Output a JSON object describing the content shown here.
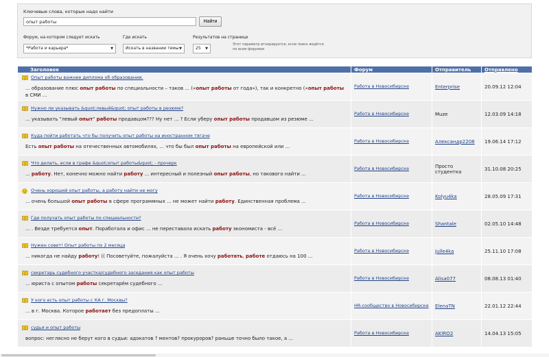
{
  "search": {
    "keywords_label": "Ключевые слова, которые надо найти",
    "keywords_value": "опыт работы",
    "find_button": "Найти",
    "forum_label": "Форум, на котором следует искать",
    "forum_value": "*Работа и карьера*",
    "where_label": "Где искать",
    "where_value": "Искать в названии темы",
    "per_page_label": "Результатов на странице",
    "per_page_value": "25",
    "per_page_note": "Этот параметр игнорируется, если поиск ведётся по всем форумам"
  },
  "table": {
    "headers": {
      "title": "Заголовок",
      "forum": "Форум",
      "sender": "Отправитель",
      "posted": "Отправлено"
    },
    "rows": [
      {
        "icon": "book-icon",
        "title": "Опыт работы важнее диплома об образовании.",
        "snippet_parts": [
          [
            "... образование плюс ",
            false
          ],
          [
            "опыт работы",
            true
          ],
          [
            " по специальности – таков ... («",
            false
          ],
          [
            "опыт работы",
            true
          ],
          [
            " от года»), так и конкретно («",
            false
          ],
          [
            "опыт работы",
            true
          ],
          [
            " в СМИ ...",
            false
          ]
        ],
        "forum": "Работа в Новосибирске",
        "sender": "Enterprise",
        "sender_link": true,
        "date": "20.09.12 12:04"
      },
      {
        "icon": "book-icon",
        "title": "Нужно ли указывать &quot;левый&quot; опыт работы в резюме?",
        "snippet_parts": [
          [
            "... указывать \"левый ",
            false
          ],
          [
            "опыт",
            true
          ],
          [
            "\" ",
            false
          ],
          [
            "работы",
            true
          ],
          [
            " продавцом??? Ну нет ... ? Если уберу ",
            false
          ],
          [
            "опыт работы",
            true
          ],
          [
            " продавцом из резюме ...",
            false
          ]
        ],
        "forum": "Работа в Новосибирске",
        "sender": "Muze",
        "sender_link": false,
        "date": "12.03.09 14:18"
      },
      {
        "icon": "book-icon",
        "title": "Куда пойти работать что бы получить опыт работы на иностранном тягаче",
        "snippet_parts": [
          [
            "Есть ",
            false
          ],
          [
            "опыт работы",
            true
          ],
          [
            " на отечественных автомобилях, ... что бы был ",
            false
          ],
          [
            "опыт работы",
            true
          ],
          [
            " на европейской или ...",
            false
          ]
        ],
        "forum": "Работа в Новосибирске",
        "sender": "Александр2208",
        "sender_link": true,
        "date": "19.06.14 17:12"
      },
      {
        "icon": "book-icon",
        "title": "Что делать, если в графе &quot;опыт работы&quot; - прочерк",
        "snippet_parts": [
          [
            "... ",
            false
          ],
          [
            "работу",
            true
          ],
          [
            ". Нет, конечно можно найти ",
            false
          ],
          [
            "работу",
            true
          ],
          [
            " ... интересный и полезный ",
            false
          ],
          [
            "опыт работы",
            true
          ],
          [
            ", но такового найти ...",
            false
          ]
        ],
        "forum": "Работа в Новосибирске",
        "sender": "Просто студентка",
        "sender_link": false,
        "date": "31.10.08 20:25"
      },
      {
        "icon": "smiley-icon",
        "title": "Очень хороший опыт работы, а работу найти не могу",
        "snippet_parts": [
          [
            "... очень большой ",
            false
          ],
          [
            "опыт работы",
            true
          ],
          [
            " в сфере программных ... не может найти ",
            false
          ],
          [
            "работу",
            true
          ],
          [
            ". Единственная проблема ...",
            false
          ]
        ],
        "forum": "Работа в Новосибирске",
        "sender": "Kolyu4ka",
        "sender_link": true,
        "date": "28.05.09 17:31"
      },
      {
        "icon": "book-icon",
        "title": "Где получать опыт работы по специальности?",
        "snippet_parts": [
          [
            "... . Везде требуется ",
            false
          ],
          [
            "опыт",
            true
          ],
          [
            ". Поработала и офис ... не переставала искать ",
            false
          ],
          [
            "работу",
            true
          ],
          [
            " экономиста - всё ...",
            false
          ]
        ],
        "forum": "Работа в Новосибирске",
        "sender": "Shantale",
        "sender_link": true,
        "date": "02.05.10 14:48"
      },
      {
        "icon": "book-icon",
        "title": "Нужен совет! Опыт работы по 2 месяца",
        "snippet_parts": [
          [
            "... никогда не найду ",
            false
          ],
          [
            "работу",
            true
          ],
          [
            "! (( Посоветуйте, пожалуйста ... . Я очень хочу ",
            false
          ],
          [
            "работать",
            true
          ],
          [
            ", ",
            false
          ],
          [
            "работе",
            true
          ],
          [
            " отдаюсь на 100 ...",
            false
          ]
        ],
        "forum": "Работа в Новосибирске",
        "sender": "Julle4ka",
        "sender_link": true,
        "date": "25.11.10 17:08"
      },
      {
        "icon": "book-icon",
        "title": "секретарь судебного участка/судебного заседания как опыт работы",
        "snippet_parts": [
          [
            "... юриста с опытом ",
            false
          ],
          [
            "работы",
            true
          ],
          [
            " секретарём судебного ...",
            false
          ]
        ],
        "forum": "Работа в Новосибирске",
        "sender": "Alisa077",
        "sender_link": true,
        "date": "08.08.13 01:40"
      },
      {
        "icon": "book-icon",
        "title": "У кого есть опыт работы с КА г. Москвы?",
        "snippet_parts": [
          [
            "... в г. Москва. Которое ",
            false
          ],
          [
            "работает",
            true
          ],
          [
            " без предоплаты ...",
            false
          ]
        ],
        "forum": "HR-сообщество в Новосибирске",
        "sender": "ElenaTN",
        "sender_link": true,
        "date": "22.01.12 22:44"
      },
      {
        "icon": "book-icon",
        "title": "судья и опыт работы",
        "snippet_parts": [
          [
            "вопрос: неглясно не берут кого в судьи: адокатов ? ментов? прокуроров? раньше точно было такое, а ...",
            false
          ]
        ],
        "forum": "Работа в Новосибирске",
        "sender": "AKIRO2",
        "sender_link": true,
        "date": "14.04.13 15:05"
      }
    ]
  },
  "colors": {
    "header_bg": "#4f6fa7",
    "link": "#1d3f87",
    "highlight": "#8b1212"
  }
}
